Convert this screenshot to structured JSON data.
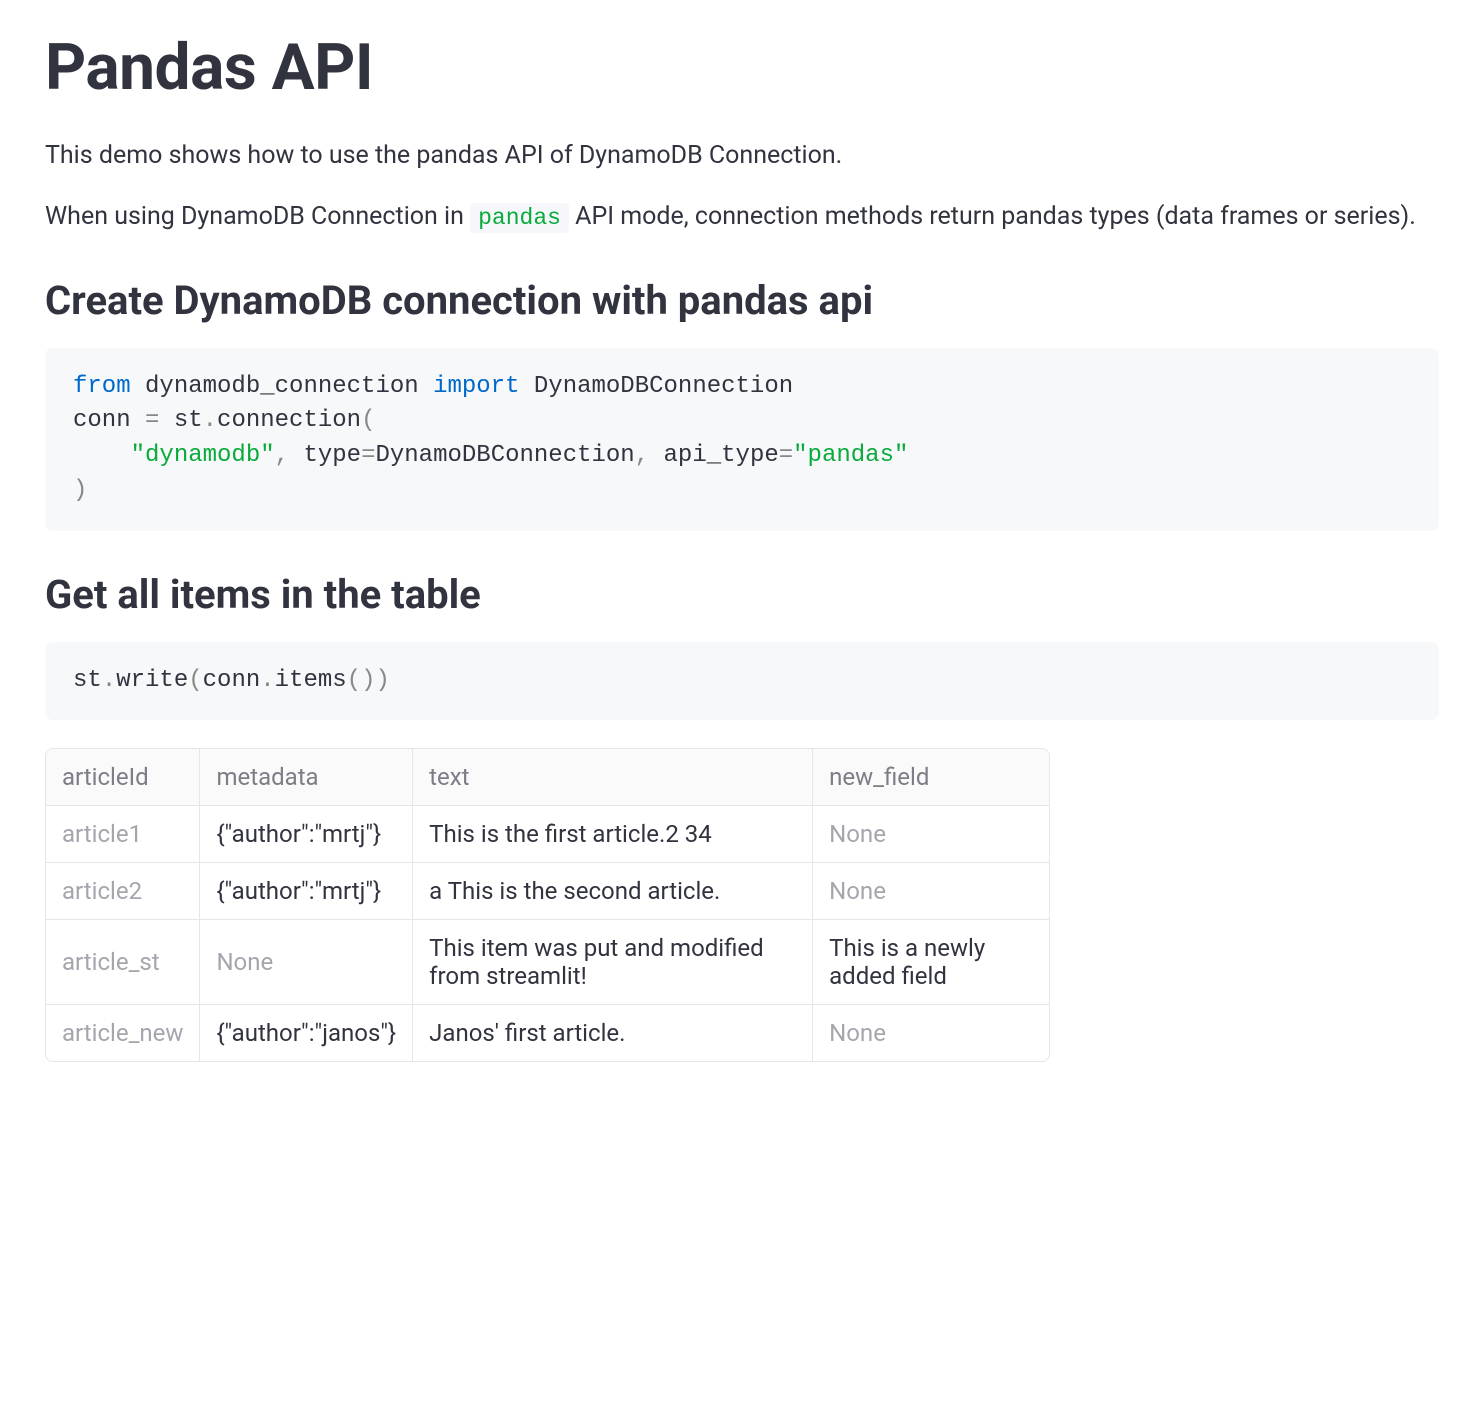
{
  "title": "Pandas API",
  "intro1": "This demo shows how to use the pandas API of DynamoDB Connection.",
  "intro2_pre": "When using DynamoDB Connection in ",
  "intro2_code": "pandas",
  "intro2_post": " API mode, connection methods return pandas types (data frames or series).",
  "section1_heading": "Create DynamoDB connection with pandas api",
  "code1": {
    "l1_kw1": "from",
    "l1_txt1": " dynamodb_connection ",
    "l1_kw2": "import",
    "l1_txt2": " DynamoDBConnection",
    "l2_txt1": "conn ",
    "l2_op1": "=",
    "l2_txt2": " st",
    "l2_op2": ".",
    "l2_txt3": "connection",
    "l2_op3": "(",
    "l3_pad": "    ",
    "l3_str1": "\"dynamodb\"",
    "l3_op1": ",",
    "l3_txt1": " type",
    "l3_op2": "=",
    "l3_txt2": "DynamoDBConnection",
    "l3_op3": ",",
    "l3_txt3": " api_type",
    "l3_op4": "=",
    "l3_str2": "\"pandas\"",
    "l4_op1": ")"
  },
  "section2_heading": "Get all items in the table",
  "code2": {
    "txt1": "st",
    "op1": ".",
    "txt2": "write",
    "op2": "(",
    "txt3": "conn",
    "op3": ".",
    "txt4": "items",
    "op4": "())"
  },
  "table": {
    "headers": [
      "articleId",
      "metadata",
      "text",
      "new_field"
    ],
    "rows": [
      {
        "id": "article1",
        "meta": "{\"author\":\"mrtj\"}",
        "text": "This is the first article.2 34",
        "newf": "None",
        "meta_faded": false,
        "newf_faded": true
      },
      {
        "id": "article2",
        "meta": "{\"author\":\"mrtj\"}",
        "text": "a This is the second article.",
        "newf": "None",
        "meta_faded": false,
        "newf_faded": true
      },
      {
        "id": "article_st",
        "meta": "None",
        "text": "This item was put and modified from streamlit!",
        "newf": "This is a newly added field",
        "meta_faded": true,
        "newf_faded": false
      },
      {
        "id": "article_new",
        "meta": "{\"author\":\"janos\"}",
        "text": "Janos' first article.",
        "newf": "None",
        "meta_faded": false,
        "newf_faded": true
      }
    ]
  }
}
